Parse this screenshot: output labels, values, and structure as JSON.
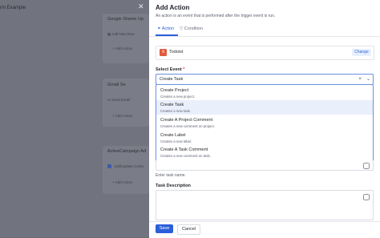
{
  "background": {
    "title": "rm Example",
    "cards": [
      {
        "name": "Google Sheets",
        "suffix": "Up",
        "items": [
          "Add New Row"
        ],
        "add": "Add Action"
      },
      {
        "name": "Gmail",
        "suffix": "Se",
        "items": [
          "Send Email"
        ],
        "add": "Add Action"
      },
      {
        "name": "ActiveCampaign",
        "suffix": "Ad",
        "items": [
          "Add/Update Conta"
        ],
        "add": "Add Action"
      }
    ]
  },
  "panel": {
    "title": "Add Action",
    "subtitle": "An action is an event that is performed after the trigger event is run.",
    "tabs": {
      "action": "Action",
      "condition": "Condition"
    },
    "app": {
      "name": "Todoist",
      "change": "Change"
    },
    "select_event": {
      "label": "Select Event",
      "required_mark": "*",
      "value": "Create Task",
      "options": [
        {
          "title": "Create Project",
          "desc": "Creates a new project."
        },
        {
          "title": "Create Task",
          "desc": "Creates a new task."
        },
        {
          "title": "Create A Project Comment",
          "desc": "Creates a new comment on project."
        },
        {
          "title": "Create Label",
          "desc": "Creates a new label."
        },
        {
          "title": "Create A Task Comment",
          "desc": "Creates a new comment on task."
        }
      ]
    },
    "task_name_hint": "Enter task name.",
    "task_description_label": "Task Description",
    "footer": {
      "save": "Save",
      "cancel": "Cancel"
    }
  }
}
